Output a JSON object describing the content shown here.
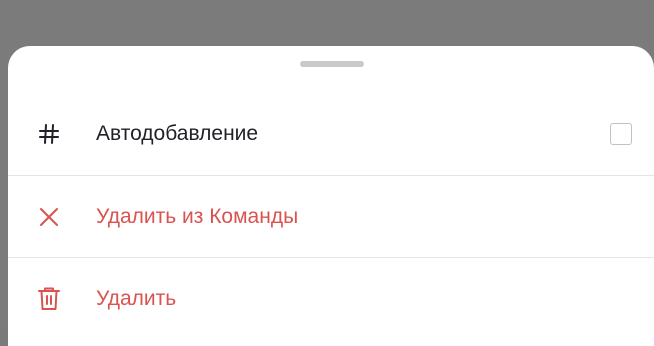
{
  "menu": {
    "items": [
      {
        "label": "Автодобавление",
        "icon": "hash-icon",
        "color": "#1f2126",
        "checked": false
      },
      {
        "label": "Удалить из Команды",
        "icon": "close-icon",
        "color": "#d9534f"
      },
      {
        "label": "Удалить",
        "icon": "trash-icon",
        "color": "#d9534f"
      }
    ]
  },
  "colors": {
    "backdrop": "#7b7b7b",
    "sheet": "#ffffff",
    "danger": "#d9534f",
    "text": "#1f2126",
    "divider": "#e3e4e6"
  }
}
